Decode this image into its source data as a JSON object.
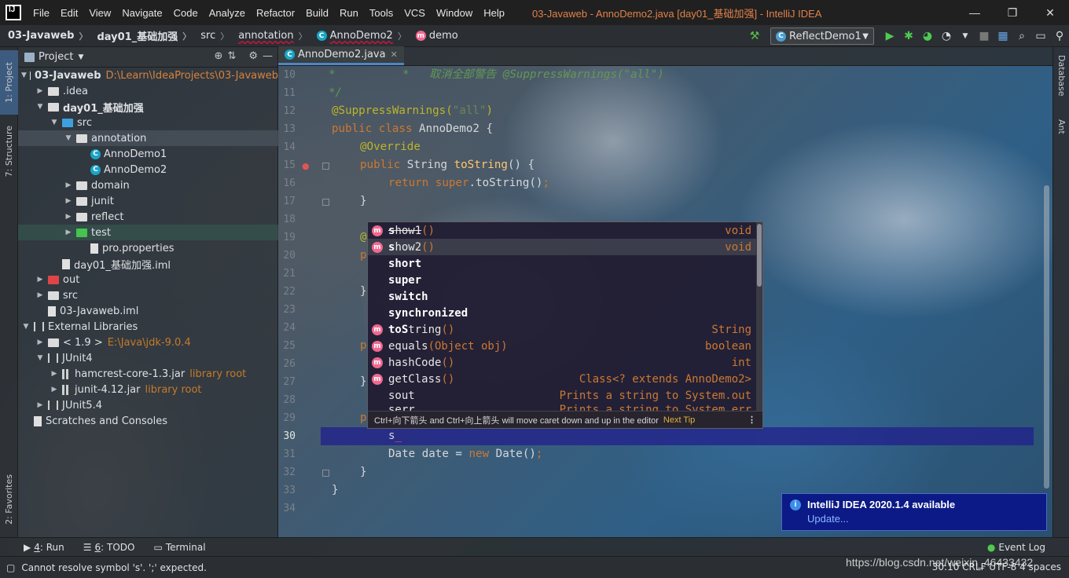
{
  "window": {
    "title": "03-Javaweb - AnnoDemo2.java [day01_基础加强] - IntelliJ IDEA",
    "logo": "IJ",
    "minimize": "—",
    "maximize": "❐",
    "close": "✕"
  },
  "menu": [
    "File",
    "Edit",
    "View",
    "Navigate",
    "Code",
    "Analyze",
    "Refactor",
    "Build",
    "Run",
    "Tools",
    "VCS",
    "Window",
    "Help"
  ],
  "breadcrumb": [
    "03-Javaweb",
    "day01_基础加强",
    "src",
    "annotation",
    "AnnoDemo2",
    "demo"
  ],
  "run_config": "ReflectDemo1",
  "left_stripe": {
    "project": "1: Project",
    "structure": "7: Structure",
    "favorites": "2: Favorites"
  },
  "right_stripe": {
    "database": "Database",
    "ant": "Ant"
  },
  "project_panel": {
    "title": "Project",
    "tree": [
      {
        "depth": 0,
        "expanded": true,
        "icon": "module",
        "label": "03-Javaweb",
        "hint": "D:\\Learn\\IdeaProjects\\03-Javaweb",
        "bold": true
      },
      {
        "depth": 1,
        "expanded": false,
        "icon": "folder",
        "label": ".idea"
      },
      {
        "depth": 1,
        "expanded": true,
        "icon": "folder",
        "label": "day01_基础加强",
        "bold": true
      },
      {
        "depth": 2,
        "expanded": true,
        "icon": "folder-blue",
        "label": "src"
      },
      {
        "depth": 3,
        "expanded": true,
        "icon": "package",
        "label": "annotation",
        "selected": true
      },
      {
        "depth": 4,
        "icon": "class",
        "label": "AnnoDemo1"
      },
      {
        "depth": 4,
        "icon": "class",
        "label": "AnnoDemo2"
      },
      {
        "depth": 3,
        "expanded": false,
        "icon": "package",
        "label": "domain"
      },
      {
        "depth": 3,
        "expanded": false,
        "icon": "package",
        "label": "junit"
      },
      {
        "depth": 3,
        "expanded": false,
        "icon": "package",
        "label": "reflect"
      },
      {
        "depth": 3,
        "expanded": false,
        "icon": "folder-green",
        "label": "test",
        "highlight": true
      },
      {
        "depth": 4,
        "icon": "properties",
        "label": "pro.properties"
      },
      {
        "depth": 2,
        "icon": "iml",
        "label": "day01_基础加强.iml"
      },
      {
        "depth": 1,
        "expanded": false,
        "icon": "folder-red",
        "label": "out"
      },
      {
        "depth": 1,
        "expanded": false,
        "icon": "folder",
        "label": "src"
      },
      {
        "depth": 1,
        "icon": "iml",
        "label": "03-Javaweb.iml"
      },
      {
        "depth": 0,
        "expanded": true,
        "icon": "library",
        "label": "External Libraries"
      },
      {
        "depth": 1,
        "expanded": false,
        "icon": "jdk",
        "label": "< 1.9 >",
        "hint": "E:\\Java\\jdk-9.0.4"
      },
      {
        "depth": 1,
        "expanded": true,
        "icon": "library",
        "label": "JUnit4"
      },
      {
        "depth": 2,
        "expanded": false,
        "icon": "jar",
        "label": "hamcrest-core-1.3.jar",
        "hint": "library root"
      },
      {
        "depth": 2,
        "expanded": false,
        "icon": "jar",
        "label": "junit-4.12.jar",
        "hint": "library root"
      },
      {
        "depth": 1,
        "expanded": false,
        "icon": "library",
        "label": "JUnit5.4"
      },
      {
        "depth": 0,
        "icon": "scratches",
        "label": "Scratches and Consoles"
      }
    ]
  },
  "editor": {
    "tab": "AnnoDemo2.java",
    "lines": [
      {
        "n": "10",
        "text": ""
      },
      {
        "n": "11",
        "text": ""
      },
      {
        "n": "12",
        "text": ""
      },
      {
        "n": "13",
        "text": ""
      },
      {
        "n": "14",
        "text": ""
      },
      {
        "n": "15",
        "text": ""
      },
      {
        "n": "16",
        "text": ""
      },
      {
        "n": "17",
        "text": ""
      },
      {
        "n": "18",
        "text": ""
      },
      {
        "n": "19",
        "text": ""
      },
      {
        "n": "20",
        "text": ""
      },
      {
        "n": "21",
        "text": ""
      },
      {
        "n": "22",
        "text": ""
      },
      {
        "n": "23",
        "text": ""
      },
      {
        "n": "24",
        "text": ""
      },
      {
        "n": "25",
        "text": ""
      },
      {
        "n": "26",
        "text": ""
      },
      {
        "n": "27",
        "text": ""
      },
      {
        "n": "28",
        "text": ""
      },
      {
        "n": "29",
        "text": ""
      },
      {
        "n": "30",
        "text": ""
      },
      {
        "n": "31",
        "text": ""
      },
      {
        "n": "32",
        "text": ""
      },
      {
        "n": "33",
        "text": ""
      },
      {
        "n": "34",
        "text": ""
      }
    ],
    "code": {
      "l10": "*          *   取消全部警告 @SuppressWarnings(\"all\")",
      "l11": "*/",
      "l12_ann": "@SuppressWarnings(",
      "l12_str": "\"all\"",
      "l12_end": ")",
      "l13_kw": "public class",
      "l13_name": " AnnoDemo2 {",
      "l14": "@Override",
      "l15_kw": "public",
      "l15_type": " String ",
      "l15_fn": "toString",
      "l15_end": "() {",
      "l16_kw": "return super",
      "l16_rest": ".toString()",
      "l16_semi": ";",
      "l17": "}",
      "l19": "@",
      "l20": "p",
      "l22": "}",
      "l25": "p",
      "l27": "}",
      "l29": "p",
      "l30": "s",
      "l31_a": "Date date = ",
      "l31_kw": "new",
      "l31_b": " Date()",
      "l31_semi": ";",
      "l32": "}",
      "l33": "}"
    }
  },
  "completion": {
    "items": [
      {
        "icon": "m",
        "bold": "s",
        "name": "how1",
        "tail": "()",
        "type": "void",
        "strike": true
      },
      {
        "icon": "m",
        "bold": "s",
        "name": "how2",
        "tail": "()",
        "type": "void",
        "selected": true
      },
      {
        "icon": "",
        "bold": "short",
        "name": "",
        "tail": "",
        "type": ""
      },
      {
        "icon": "",
        "bold": "super",
        "name": "",
        "tail": "",
        "type": ""
      },
      {
        "icon": "",
        "bold": "switch",
        "name": "",
        "tail": "",
        "type": ""
      },
      {
        "icon": "",
        "bold": "synchronized",
        "name": "",
        "tail": "",
        "type": ""
      },
      {
        "icon": "m",
        "bold": "toS",
        "name": "tring",
        "tail": "()",
        "type": "String"
      },
      {
        "icon": "m",
        "bold": "",
        "name": "equals",
        "tail": "(Object obj)",
        "type": "boolean"
      },
      {
        "icon": "m",
        "bold": "",
        "name": "hashCode",
        "tail": "()",
        "type": "int"
      },
      {
        "icon": "m",
        "bold": "",
        "name": "getClass",
        "tail": "()",
        "type": "Class<? extends AnnoDemo2>"
      },
      {
        "icon": "",
        "bold": "",
        "name": "sout",
        "tail": "",
        "type": "Prints a string to System.out"
      },
      {
        "icon": "",
        "bold": "",
        "name": "serr",
        "tail": "",
        "type": "Prints a string to System.err"
      }
    ],
    "footer": "Ctrl+向下箭头 and Ctrl+向上箭头 will move caret down and up in the editor",
    "next_tip": "Next Tip",
    "more": "⋮"
  },
  "notification": {
    "title": "IntelliJ IDEA 2020.1.4 available",
    "link": "Update..."
  },
  "bottom_tools": [
    {
      "key": "4",
      "label": ": Run",
      "icon": "▶"
    },
    {
      "key": "6",
      "label": ": TODO",
      "icon": "☰"
    },
    {
      "key": "",
      "label": "Terminal",
      "icon": "▭"
    }
  ],
  "event_log": "Event Log",
  "status": {
    "message": "Cannot resolve symbol 's'. ';' expected.",
    "right": "30:10  CRLF  UTF-8  4 spaces"
  },
  "watermark": "https://blog.csdn.net/weixin_46433432",
  "colors": {
    "accent": "#4a88c7",
    "keyword": "#cc7832",
    "annotation": "#bbb529",
    "string": "#6a8759"
  }
}
